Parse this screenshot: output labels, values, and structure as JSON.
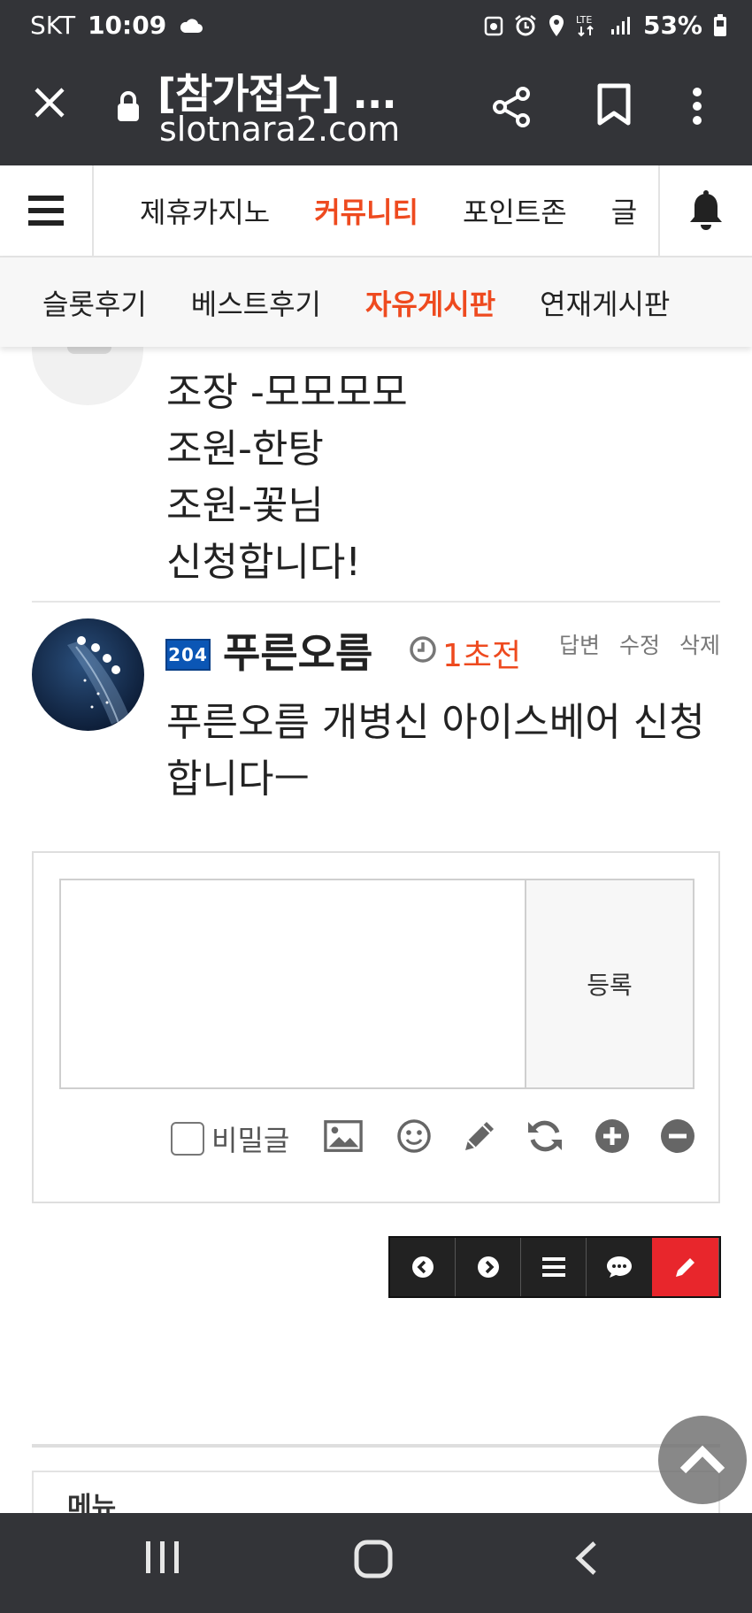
{
  "status": {
    "carrier": "SKT",
    "time": "10:09",
    "battery": "53%"
  },
  "browser": {
    "title": "[참가접수] ...",
    "url": "slotnara2.com"
  },
  "nav": {
    "items": [
      "제휴카지노",
      "커뮤니티",
      "포인트존",
      "글"
    ],
    "active_index": 1,
    "accent": "#ee4a1f"
  },
  "subnav": {
    "items": [
      "슬롯후기",
      "베스트후기",
      "자유게시판",
      "연재게시판"
    ],
    "active_index": 2
  },
  "prev_comment": {
    "lines": [
      "조장 -모모모모",
      "조원-한탕",
      "조원-꽃님",
      "신청합니다!"
    ]
  },
  "comment": {
    "level": "204",
    "nickname": "푸른오름",
    "time": "1초전",
    "actions": [
      "답변",
      "수정",
      "삭제"
    ],
    "text": "푸른오름 개병신 아이스베어 신청합니다ㅡ"
  },
  "form": {
    "submit_label": "등록",
    "secret_label": "비밀글",
    "tools": [
      "image-icon",
      "emoticon-icon",
      "pencil-icon",
      "refresh-icon",
      "plus-icon",
      "minus-icon"
    ]
  },
  "toolbar": {
    "buttons": [
      "prev-icon",
      "next-icon",
      "list-icon",
      "comment-icon",
      "write-icon"
    ]
  },
  "footer": {
    "menu_label": "메뉴"
  }
}
